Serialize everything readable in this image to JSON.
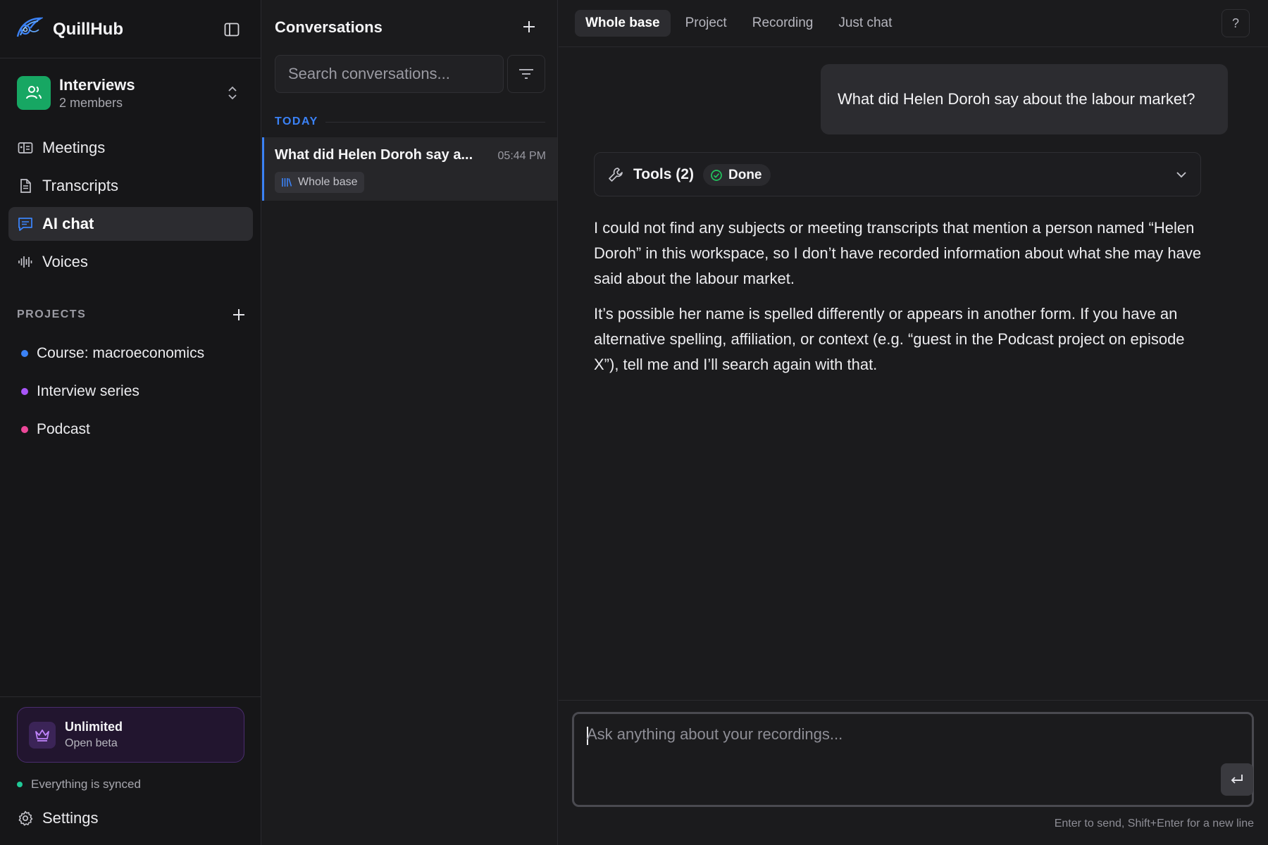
{
  "app": {
    "name": "QuillHub"
  },
  "workspace": {
    "name": "Interviews",
    "members": "2 members"
  },
  "nav": [
    {
      "label": "Meetings",
      "icon": "meetings-icon"
    },
    {
      "label": "Transcripts",
      "icon": "document-icon"
    },
    {
      "label": "AI chat",
      "icon": "chat-icon",
      "active": true
    },
    {
      "label": "Voices",
      "icon": "waveform-icon"
    }
  ],
  "projects": {
    "title": "PROJECTS",
    "items": [
      {
        "label": "Course: macroeconomics",
        "color": "#3b82f6"
      },
      {
        "label": "Interview series",
        "color": "#a855f7"
      },
      {
        "label": "Podcast",
        "color": "#ec4899"
      }
    ]
  },
  "plan": {
    "title": "Unlimited",
    "subtitle": "Open beta"
  },
  "sync": {
    "status": "Everything is synced"
  },
  "settings": {
    "label": "Settings"
  },
  "conversations": {
    "title": "Conversations",
    "search_placeholder": "Search conversations...",
    "group": "TODAY",
    "items": [
      {
        "title": "What did Helen Doroh say a...",
        "time": "05:44 PM",
        "tag": "Whole base"
      }
    ]
  },
  "chat": {
    "tabs": [
      {
        "label": "Whole base",
        "active": true
      },
      {
        "label": "Project"
      },
      {
        "label": "Recording"
      },
      {
        "label": "Just chat"
      }
    ],
    "help": "?",
    "user_message": "What did Helen Doroh say about the labour market?",
    "tools": {
      "label": "Tools (2)",
      "status": "Done"
    },
    "answer": [
      "I could not find any subjects or meeting transcripts that mention a person named “Helen Doroh” in this workspace, so I don’t have recorded information about what she may have said about the labour market.",
      "It’s possible her name is spelled differently or appears in another form. If you have an alternative spelling, affiliation, or context (e.g. “guest in the Podcast project on episode X”), tell me and I’ll search again with that."
    ],
    "composer_placeholder": "Ask anything about your recordings...",
    "hint": "Enter to send, Shift+Enter for a new line"
  },
  "colors": {
    "accent": "#3b82f6",
    "workspace_avatar": "#17a763",
    "plan_border": "#4a2d6e",
    "sync_dot": "#20c997"
  }
}
